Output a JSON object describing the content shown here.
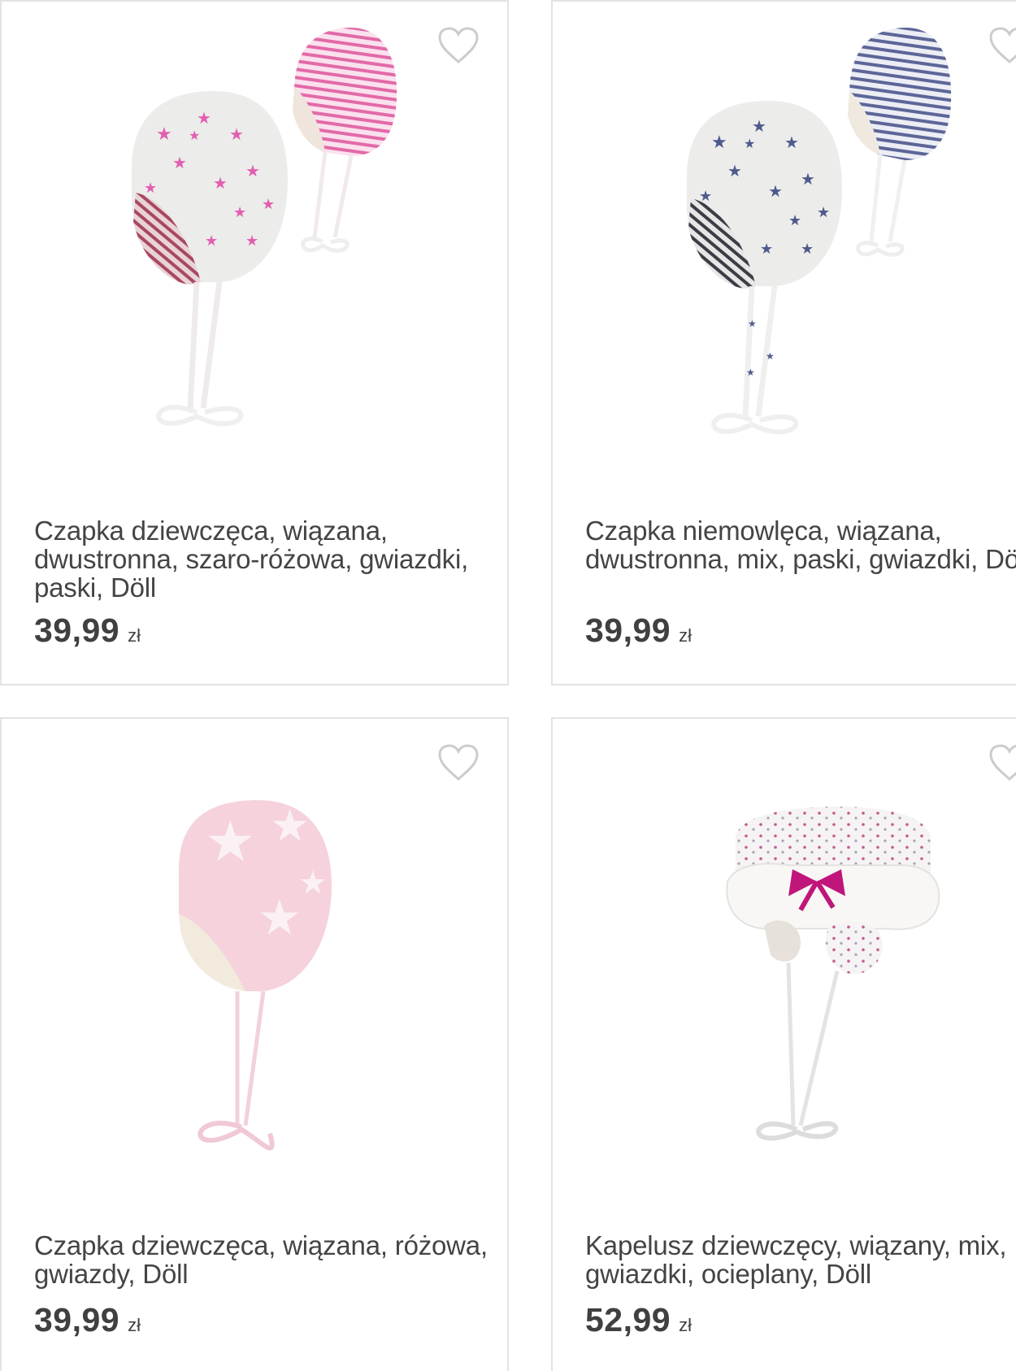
{
  "products": [
    {
      "title": "Czapka dziewczęca, wiązana, dwustronna, szaro-różowa, gwiazdki, paski, Döll",
      "price": "39,99",
      "currency": "zł",
      "image": "pink-star-baby-hat-with-striped-hat-icon"
    },
    {
      "title": "Czapka niemowlęca, wiązana, dwustronna, mix, paski, gwiazdki, Döll",
      "price": "39,99",
      "currency": "zł",
      "image": "navy-star-baby-hat-with-striped-hat-icon"
    },
    {
      "title": "Czapka dziewczęca, wiązana, różowa, gwiazdy, Döll",
      "price": "39,99",
      "currency": "zł",
      "image": "pink-star-hat-icon"
    },
    {
      "title": "Kapelusz dziewczęcy, wiązany, mix, gwiazdki, ocieplany, Döll",
      "price": "52,99",
      "currency": "zł",
      "image": "fur-trim-bow-hat-icon"
    }
  ],
  "icons": {
    "favorite": "heart-outline-icon"
  },
  "colors": {
    "pink": "#e0569b",
    "navy": "#4f5a8c",
    "light_pink": "#f5d2dc",
    "magenta_bow": "#c0157a",
    "heart": "#cccccc",
    "border": "#e3e3e3"
  }
}
